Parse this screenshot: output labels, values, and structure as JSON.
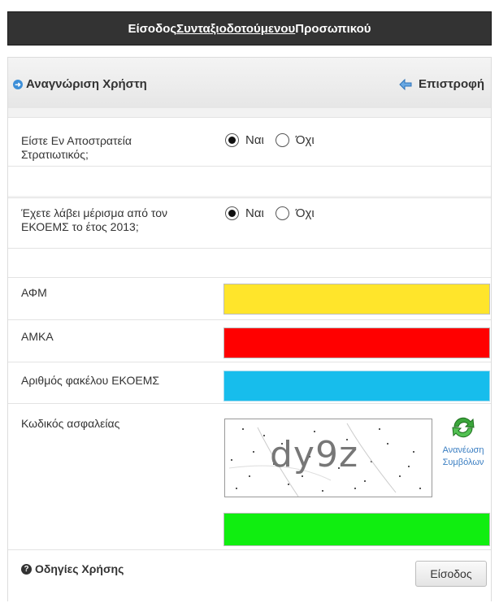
{
  "header": {
    "title_part1": "Είσοδος ",
    "title_underlined": "Συνταξιοδοτούμενου",
    "title_part2": " Προσωπικού"
  },
  "panel": {
    "heading": "Αναγνώριση Χρήστη",
    "back_label": "Επιστροφή"
  },
  "questions": [
    {
      "label_line1": "Είστε Εν Αποστρατεία",
      "label_line2": "Στρατιωτικός;",
      "yes": "Ναι",
      "no": "Όχι",
      "selected": "yes"
    },
    {
      "label_line1": "Έχετε λάβει μέρισμα από τον",
      "label_line2": "ΕΚΟΕΜΣ το έτος 2013;",
      "yes": "Ναι",
      "no": "Όχι",
      "selected": "yes"
    }
  ],
  "fields": {
    "afm": {
      "label": "ΑΦΜ",
      "value": "",
      "color": "#ffe52b"
    },
    "amka": {
      "label": "ΑΜΚΑ",
      "value": "",
      "color": "#ff0000"
    },
    "folder": {
      "label": "Αριθμός φακέλου ΕΚΟΕΜΣ",
      "value": "",
      "color": "#17bdec"
    },
    "security": {
      "label": "Κωδικός ασφαλείας",
      "value": "",
      "color": "#10ee10"
    }
  },
  "captcha": {
    "text": "dy9z",
    "refresh_line1": "Ανανέωση",
    "refresh_line2": "Συμβόλων"
  },
  "footer": {
    "help_label": "Οδηγίες Χρήσης",
    "submit_label": "Είσοδος"
  },
  "icons": {
    "heading": "arrow-right-icon",
    "back": "back-arrow-icon",
    "refresh": "refresh-icon",
    "help": "question-icon"
  },
  "colors": {
    "header_bg": "#333333",
    "link": "#3a7ec2"
  }
}
